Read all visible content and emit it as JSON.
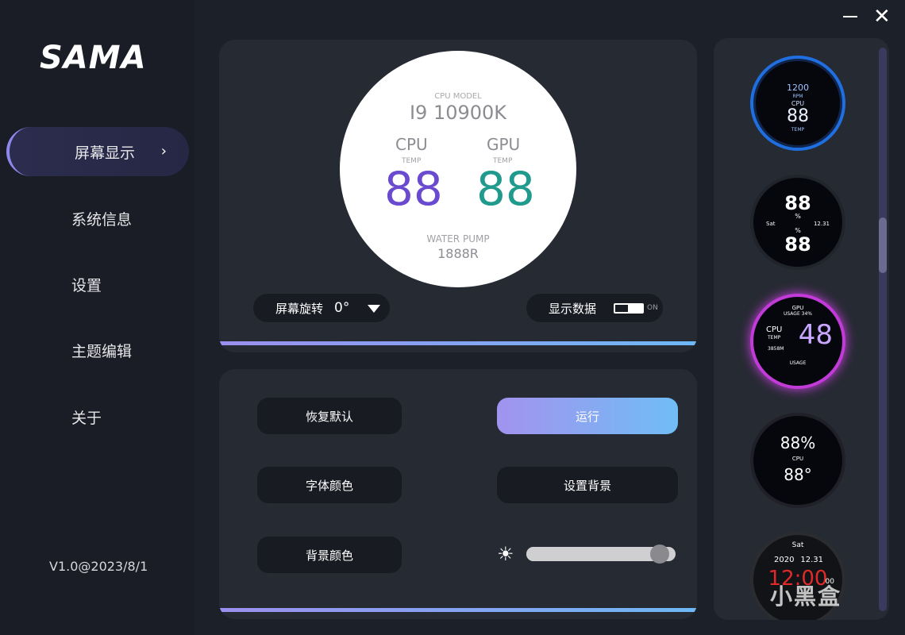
{
  "app": {
    "logo": "SAMA",
    "version": "V1.0@2023/8/1"
  },
  "colors": {
    "accent_start": "#9b8ff0",
    "accent_end": "#6fb8f5",
    "cpu_value": "#6a4bcf",
    "gpu_value": "#1f9a8c"
  },
  "sidebar": {
    "items": [
      {
        "label": "屏幕显示",
        "active": true
      },
      {
        "label": "系统信息",
        "active": false
      },
      {
        "label": "设置",
        "active": false
      },
      {
        "label": "主题编辑",
        "active": false
      },
      {
        "label": "关于",
        "active": false
      }
    ]
  },
  "preview": {
    "cpu_model_label": "CPU MODEL",
    "cpu_model": "I9 10900K",
    "cpu_label": "CPU",
    "gpu_label": "GPU",
    "temp_label": "TEMP",
    "cpu_temp": "88",
    "gpu_temp": "88",
    "pump_label": "WATER PUMP",
    "pump_value": "1888R"
  },
  "controls": {
    "rotate_label": "屏幕旋转",
    "rotate_value": "0°",
    "show_data_label": "显示数据",
    "toggle_state": "ON"
  },
  "actions": {
    "restore": "恢复默认",
    "run": "运行",
    "font_color": "字体颜色",
    "set_background": "设置背景",
    "bg_color": "背景颜色",
    "brightness": 0.95
  },
  "themes": [
    {
      "top": "1200",
      "unit": "RPM",
      "label": "CPU",
      "value": "88",
      "sub": "TEMP"
    },
    {
      "value_a": "88",
      "unit_a": "%",
      "day": "Sat",
      "date": "12.31",
      "value_b": "88",
      "unit_b": "%"
    },
    {
      "top_label": "GPU",
      "usage": "USAGE 34%",
      "label": "CPU",
      "temp": "TEMP",
      "value": "48",
      "mem": "3858M",
      "bottom": "USAGE"
    },
    {
      "percent": "88%",
      "label": "CPU",
      "temp": "88°"
    },
    {
      "day": "Sat",
      "year": "2020",
      "date": "12.31",
      "time": "12:00",
      "sec": "00"
    }
  ],
  "watermark": "小黑盒"
}
